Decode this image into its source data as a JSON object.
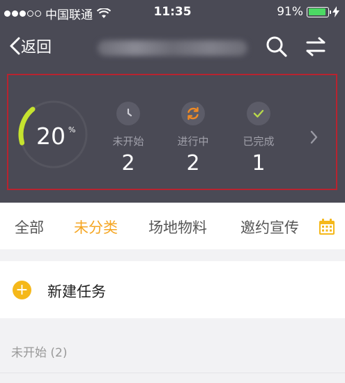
{
  "status_bar": {
    "carrier": "中国联通",
    "time": "11:35",
    "battery": "91%",
    "battery_level": 0.91
  },
  "nav": {
    "back_label": "返回"
  },
  "summary": {
    "progress_percent": 20,
    "progress_value": "20",
    "progress_unit": "%",
    "stats": [
      {
        "label": "未开始",
        "value": "2",
        "icon": "clock-icon",
        "color": "#d0d0d8"
      },
      {
        "label": "进行中",
        "value": "2",
        "icon": "refresh-icon",
        "color": "#f08a24"
      },
      {
        "label": "已完成",
        "value": "1",
        "icon": "check-icon",
        "color": "#b7d84b"
      }
    ],
    "gauge_color": "#c6e32f"
  },
  "tabs": [
    {
      "label": "全部",
      "active": false
    },
    {
      "label": "未分类",
      "active": true
    },
    {
      "label": "场地物料",
      "active": false
    },
    {
      "label": "邀约宣传",
      "active": false
    }
  ],
  "new_task": {
    "label": "新建任务"
  },
  "section": {
    "title": "未开始 (2)"
  },
  "colors": {
    "accent": "#f5a623",
    "header_bg": "#4a4a55",
    "highlight_border": "#b8232f"
  }
}
